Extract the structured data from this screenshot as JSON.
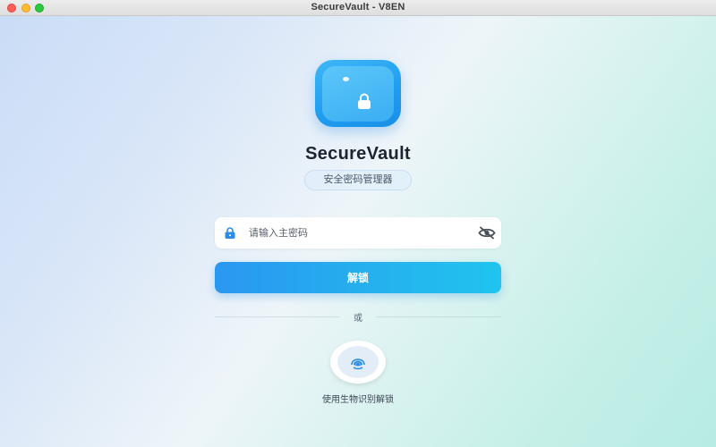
{
  "window": {
    "title": "SecureVault - V8EN"
  },
  "app": {
    "name": "SecureVault",
    "subtitle": "安全密码管理器",
    "icon": "lock-icon"
  },
  "login": {
    "password_placeholder": "请输入主密码",
    "password_value": "",
    "unlock_label": "解锁",
    "or_label": "或",
    "biometric_label": "使用生物识别解锁"
  },
  "icons": {
    "field_lock": "lock-icon",
    "toggle_visibility": "eye-slash-icon",
    "biometric": "fingerprint-icon"
  },
  "colors": {
    "accent": "#2a97f0",
    "accent_end": "#20c4ee",
    "close": "#fe5f57",
    "minimize": "#febc2e",
    "maximize": "#28c840"
  }
}
